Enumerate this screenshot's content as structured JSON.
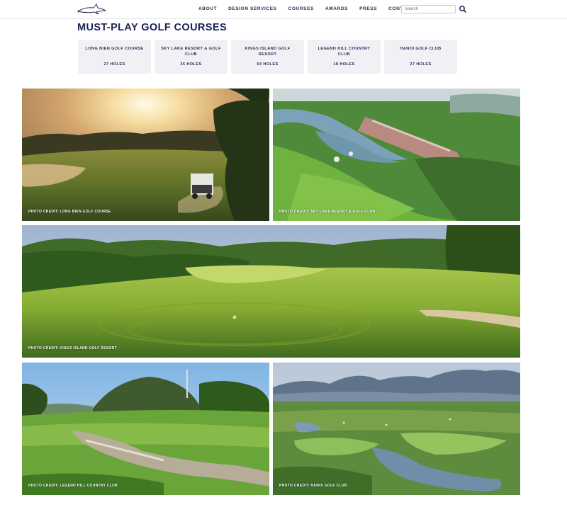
{
  "header": {
    "nav": [
      "ABOUT",
      "DESIGN SERVICES",
      "COURSES",
      "AWARDS",
      "PRESS",
      "CONTACT"
    ],
    "search_placeholder": "Search"
  },
  "main": {
    "title": "MUST-PLAY GOLF COURSES",
    "courses": [
      {
        "name": "LONG BIEN GOLF COURSE",
        "holes": "27 HOLES"
      },
      {
        "name": "SKY LAKE RESORT & GOLF CLUB",
        "holes": "36 HOLES"
      },
      {
        "name": "KINGS ISLAND GOLF RESORT",
        "holes": "54 HOLES"
      },
      {
        "name": "LEGEND HILL COUNTRY CLUB",
        "holes": "18 HOLES"
      },
      {
        "name": "HANOI GOLF CLUB",
        "holes": "27 HOLES"
      }
    ],
    "photos": [
      {
        "credit": "PHOTO CREDIT: LONG BIEN GOLF COURSE"
      },
      {
        "credit": "PHOTO CREDIT: SKY LAKE RESORT & GOLF CLUB"
      },
      {
        "credit": "PHOTO CREDIT: KINGS ISLAND GOLF RESORT"
      },
      {
        "credit": "PHOTO CREDIT: LEGEND HILL COUNTRY CLUB"
      },
      {
        "credit": "PHOTO CREDIT: HANOI GOLF CLUB"
      }
    ]
  },
  "colors": {
    "brand_navy": "#1c2158",
    "card_bg": "#f1f1f5"
  },
  "icons": [
    "shark-logo",
    "search-icon"
  ]
}
